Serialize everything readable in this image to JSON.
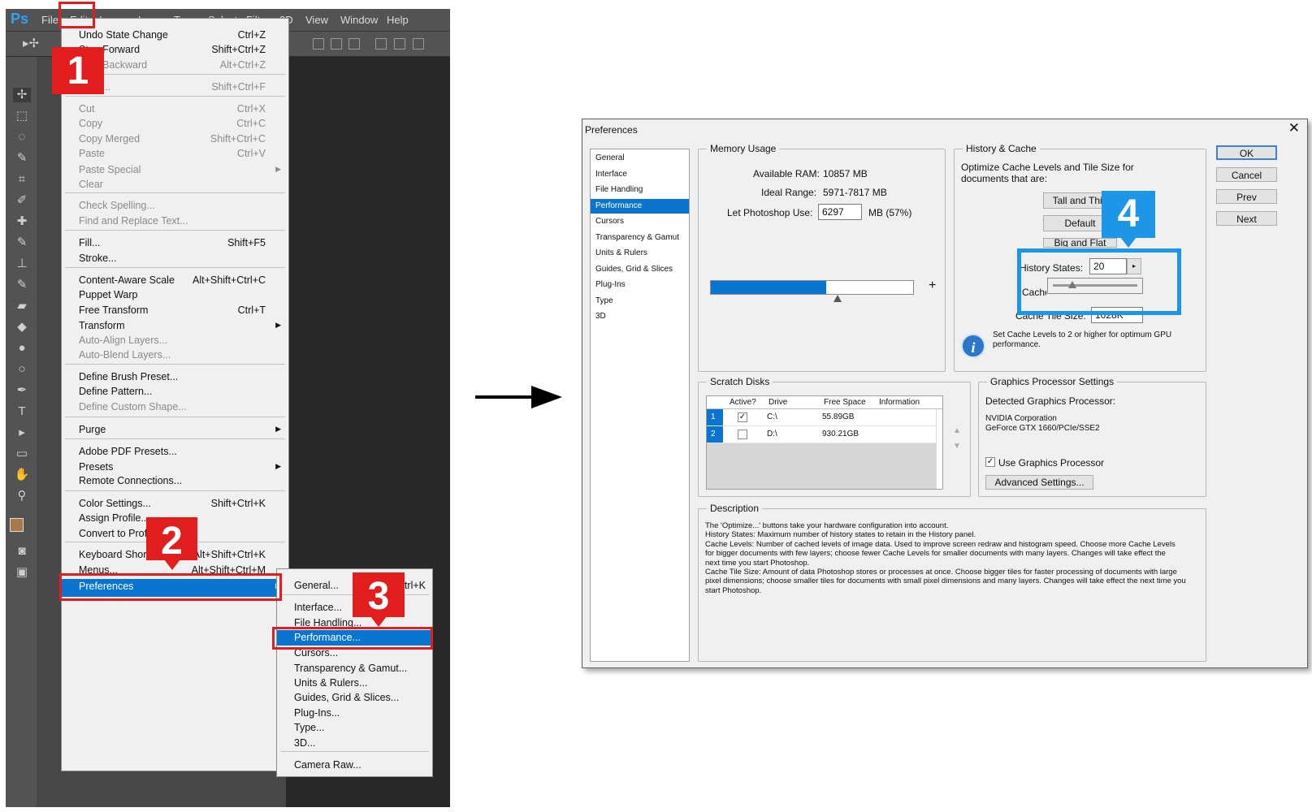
{
  "photoshop": {
    "logo": "Ps",
    "menubar": [
      "File",
      "Edit",
      "Image",
      "Layer",
      "Type",
      "Select",
      "Filter",
      "3D",
      "View",
      "Window",
      "Help"
    ],
    "edit_menu": [
      {
        "label": "Undo State Change",
        "shortcut": "Ctrl+Z",
        "disabled": false
      },
      {
        "label": "Step Forward",
        "shortcut": "Shift+Ctrl+Z",
        "disabled": false
      },
      {
        "label": "Step Backward",
        "shortcut": "Alt+Ctrl+Z",
        "disabled": true
      },
      {
        "label": "Fade...",
        "shortcut": "Shift+Ctrl+F",
        "disabled": true
      },
      {
        "label": "Cut",
        "shortcut": "Ctrl+X",
        "disabled": true
      },
      {
        "label": "Copy",
        "shortcut": "Ctrl+C",
        "disabled": true
      },
      {
        "label": "Copy Merged",
        "shortcut": "Shift+Ctrl+C",
        "disabled": true
      },
      {
        "label": "Paste",
        "shortcut": "Ctrl+V",
        "disabled": true
      },
      {
        "label": "Paste Special",
        "shortcut": "",
        "disabled": true,
        "submenu": true
      },
      {
        "label": "Clear",
        "shortcut": "",
        "disabled": true
      },
      {
        "label": "Check Spelling...",
        "shortcut": "",
        "disabled": true
      },
      {
        "label": "Find and Replace Text...",
        "shortcut": "",
        "disabled": true
      },
      {
        "label": "Fill...",
        "shortcut": "Shift+F5",
        "disabled": false
      },
      {
        "label": "Stroke...",
        "shortcut": "",
        "disabled": false
      },
      {
        "label": "Content-Aware Scale",
        "shortcut": "Alt+Shift+Ctrl+C",
        "disabled": false
      },
      {
        "label": "Puppet Warp",
        "shortcut": "",
        "disabled": false
      },
      {
        "label": "Free Transform",
        "shortcut": "Ctrl+T",
        "disabled": false
      },
      {
        "label": "Transform",
        "shortcut": "",
        "disabled": false,
        "submenu": true
      },
      {
        "label": "Auto-Align Layers...",
        "shortcut": "",
        "disabled": true
      },
      {
        "label": "Auto-Blend Layers...",
        "shortcut": "",
        "disabled": true
      },
      {
        "label": "Define Brush Preset...",
        "shortcut": "",
        "disabled": false
      },
      {
        "label": "Define Pattern...",
        "shortcut": "",
        "disabled": false
      },
      {
        "label": "Define Custom Shape...",
        "shortcut": "",
        "disabled": true
      },
      {
        "label": "Purge",
        "shortcut": "",
        "disabled": false,
        "submenu": true
      },
      {
        "label": "Adobe PDF Presets...",
        "shortcut": "",
        "disabled": false
      },
      {
        "label": "Presets",
        "shortcut": "",
        "disabled": false,
        "submenu": true
      },
      {
        "label": "Remote Connections...",
        "shortcut": "",
        "disabled": false
      },
      {
        "label": "Color Settings...",
        "shortcut": "Shift+Ctrl+K",
        "disabled": false
      },
      {
        "label": "Assign Profile...",
        "shortcut": "",
        "disabled": false
      },
      {
        "label": "Convert to Profile...",
        "shortcut": "",
        "disabled": false
      },
      {
        "label": "Keyboard Shortcuts...",
        "shortcut": "Alt+Shift+Ctrl+K",
        "disabled": false
      },
      {
        "label": "Menus...",
        "shortcut": "Alt+Shift+Ctrl+M",
        "disabled": false
      },
      {
        "label": "Preferences",
        "shortcut": "",
        "disabled": false,
        "submenu": true,
        "selected": true
      }
    ],
    "pref_menu": [
      {
        "label": "General...",
        "shortcut": "Ctrl+K"
      },
      {
        "label": "Interface...",
        "shortcut": ""
      },
      {
        "label": "File Handling...",
        "shortcut": ""
      },
      {
        "label": "Performance...",
        "shortcut": "",
        "selected": true
      },
      {
        "label": "Cursors...",
        "shortcut": ""
      },
      {
        "label": "Transparency & Gamut...",
        "shortcut": ""
      },
      {
        "label": "Units & Rulers...",
        "shortcut": ""
      },
      {
        "label": "Guides, Grid & Slices...",
        "shortcut": ""
      },
      {
        "label": "Plug-Ins...",
        "shortcut": ""
      },
      {
        "label": "Type...",
        "shortcut": ""
      },
      {
        "label": "3D...",
        "shortcut": ""
      },
      {
        "label": "Camera Raw...",
        "shortcut": ""
      }
    ]
  },
  "steps": {
    "one": "1",
    "two": "2",
    "three": "3",
    "four": "4"
  },
  "preferences": {
    "title": "Preferences",
    "close": "✕",
    "categories": [
      "General",
      "Interface",
      "File Handling",
      "Performance",
      "Cursors",
      "Transparency & Gamut",
      "Units & Rulers",
      "Guides, Grid & Slices",
      "Plug-Ins",
      "Type",
      "3D"
    ],
    "selected_category": "Performance",
    "buttons": {
      "ok": "OK",
      "cancel": "Cancel",
      "prev": "Prev",
      "next": "Next"
    },
    "memory": {
      "legend": "Memory Usage",
      "available_label": "Available RAM:",
      "available_value": "10857 MB",
      "ideal_label": "Ideal Range:",
      "ideal_value": "5971-7817 MB",
      "let_label": "Let Photoshop Use:",
      "let_value": "6297",
      "let_unit": "MB (57%)",
      "slider_fraction": 0.57,
      "minus": "−",
      "plus": "+"
    },
    "history_cache": {
      "legend": "History & Cache",
      "intro": "Optimize Cache Levels and Tile Size for documents that are:",
      "btn_tall": "Tall and Thin",
      "btn_default": "Default",
      "btn_big": "Big and Flat",
      "history_label": "History States:",
      "history_value": "20",
      "cache_levels_label": "Cache Levels:",
      "tile_label": "Cache Tile Size:",
      "tile_value": "1028K",
      "info": "Set Cache Levels to 2 or higher for optimum GPU performance."
    },
    "scratch": {
      "legend": "Scratch Disks",
      "headers": [
        "Active?",
        "Drive",
        "Free Space",
        "Information"
      ],
      "rows": [
        {
          "idx": "1",
          "active": true,
          "drive": "C:\\",
          "free": "55.89GB",
          "info": ""
        },
        {
          "idx": "2",
          "active": false,
          "drive": "D:\\",
          "free": "930.21GB",
          "info": ""
        }
      ]
    },
    "gpu": {
      "legend": "Graphics Processor Settings",
      "detected_label": "Detected Graphics Processor:",
      "vendor": "NVIDIA Corporation",
      "model": "GeForce GTX 1660/PCIe/SSE2",
      "use_label": "Use Graphics Processor",
      "use_checked": true,
      "advanced": "Advanced Settings..."
    },
    "description": {
      "legend": "Description",
      "lines": [
        "The 'Optimize...' buttons take your hardware configuration into account.",
        "History States: Maximum number of history states to retain in the History panel.",
        "Cache Levels: Number of cached levels of image data.  Used to improve screen redraw and histogram speed.  Choose more Cache Levels",
        "for bigger documents with few layers; choose fewer Cache Levels for smaller documents with many layers. Changes will take effect the",
        "next time you start Photoshop.",
        "Cache Tile Size: Amount of data Photoshop stores or processes at once. Choose bigger tiles for faster processing of documents with large",
        "pixel dimensions; choose smaller tiles for documents with small pixel dimensions and many layers. Changes will take effect the next time you",
        "start Photoshop."
      ]
    }
  }
}
